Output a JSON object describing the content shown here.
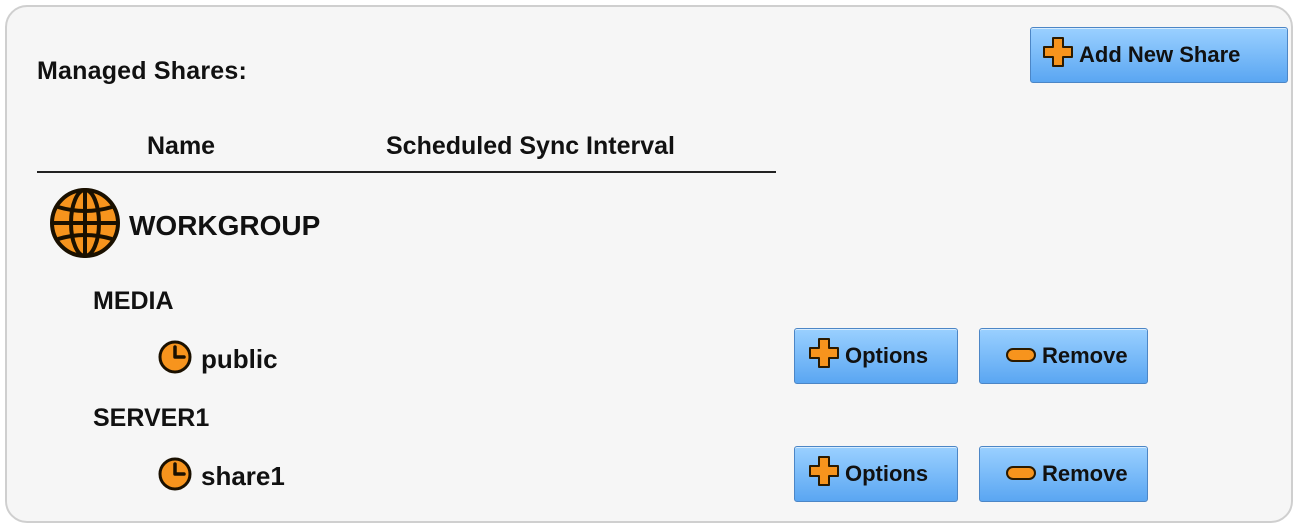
{
  "panel": {
    "title": "Managed Shares:",
    "add_button_label": "Add New Share"
  },
  "table": {
    "columns": [
      "Name",
      "Scheduled Sync Interval"
    ]
  },
  "workgroup": {
    "name": "WORKGROUP",
    "icon": "globe-icon",
    "servers": [
      {
        "name": "MEDIA",
        "shares": [
          {
            "name": "public",
            "icon": "clock-icon",
            "options_label": "Options",
            "remove_label": "Remove"
          }
        ]
      },
      {
        "name": "SERVER1",
        "shares": [
          {
            "name": "share1",
            "icon": "clock-icon",
            "options_label": "Options",
            "remove_label": "Remove"
          }
        ]
      }
    ]
  },
  "colors": {
    "button_top": "#9ad0ff",
    "button_bottom": "#5aa6f2",
    "icon_orange": "#f7941d",
    "panel_bg": "#f6f6f6"
  }
}
